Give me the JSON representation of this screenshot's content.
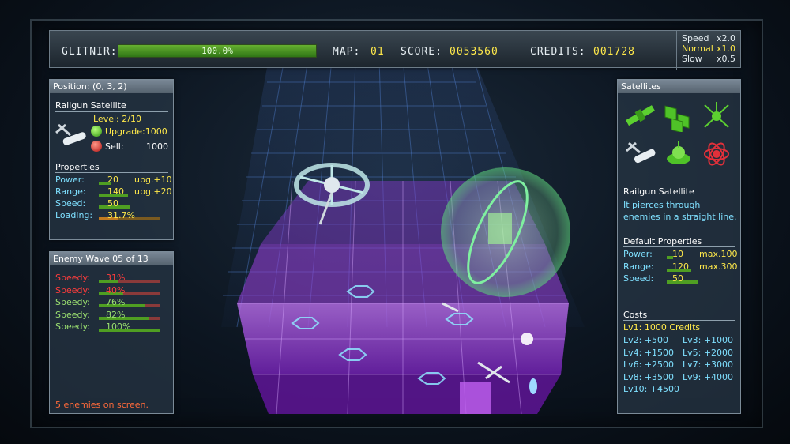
{
  "hud": {
    "ship_label": "GLITNIR:",
    "health_text": "100.0%",
    "health_fraction": 1.0,
    "map_label": "MAP:",
    "map_value": "01",
    "score_label": "SCORE:",
    "score_value": "0053560",
    "credits_label": "CREDITS:",
    "credits_value": "001728",
    "speed_options": [
      {
        "name": "Speed",
        "mult": "x2.0",
        "active": false
      },
      {
        "name": "Normal",
        "mult": "x1.0",
        "active": true
      },
      {
        "name": "Slow",
        "mult": "x0.5",
        "active": false
      }
    ]
  },
  "selected": {
    "position": "Position: (0, 3, 2)",
    "name": "Railgun Satellite",
    "level": "Level: 2/10",
    "upgrade_label": "Upgrade:1000",
    "sell_label": "Sell:",
    "sell_value": "1000",
    "properties_title": "Properties",
    "props": [
      {
        "label": "Power:",
        "value": "20",
        "extra": "upg.+10",
        "fraction": 0.2
      },
      {
        "label": "Range:",
        "value": "140",
        "extra": "upg.+20",
        "fraction": 0.47
      },
      {
        "label": "Speed:",
        "value": "50",
        "extra": "",
        "fraction": 0.5
      },
      {
        "label": "Loading:",
        "value": "31.7%",
        "extra": "",
        "fraction": 0.317
      }
    ]
  },
  "wave": {
    "title": "Enemy Wave 05 of 13",
    "enemies": [
      {
        "name": "Speedy:",
        "value": "31%",
        "health": 0.31,
        "color": "#ff3c3c"
      },
      {
        "name": "Speedy:",
        "value": "40%",
        "health": 0.4,
        "color": "#ff3c3c"
      },
      {
        "name": "Speedy:",
        "value": "76%",
        "health": 0.76,
        "color": "#9be070"
      },
      {
        "name": "Speedy:",
        "value": "82%",
        "health": 0.82,
        "color": "#9be070"
      },
      {
        "name": "Speedy:",
        "value": "100%",
        "health": 1.0,
        "color": "#9be070"
      }
    ],
    "footer": "5 enemies on screen."
  },
  "satellites": {
    "title": "Satellites",
    "icons": [
      "solar-satellite-icon",
      "panel-satellite-icon",
      "network-satellite-icon",
      "railgun-satellite-icon",
      "dish-satellite-icon",
      "orbital-satellite-icon"
    ],
    "info_name": "Railgun Satellite",
    "info_desc": "It pierces through enemies in a straight line.",
    "default_title": "Default Properties",
    "defaults": [
      {
        "label": "Power:",
        "value": "10",
        "extra": "max.100",
        "fraction": 0.1
      },
      {
        "label": "Range:",
        "value": "120",
        "extra": "max.300",
        "fraction": 0.4
      },
      {
        "label": "Speed:",
        "value": "50",
        "extra": "",
        "fraction": 0.5
      }
    ],
    "costs_title": "Costs",
    "costs_first": "Lv1: 1000 Credits",
    "costs": [
      [
        "Lv2: +500",
        "Lv3: +1000"
      ],
      [
        "Lv4: +1500",
        "Lv5: +2000"
      ],
      [
        "Lv6: +2500",
        "Lv7: +3000"
      ],
      [
        "Lv8: +3500",
        "Lv9: +4000"
      ],
      [
        "Lv10: +4500",
        ""
      ]
    ]
  },
  "colors": {
    "accent_yellow": "#ffe94a",
    "health_green": "#4f9e22",
    "grid_purple": "#9a35d8",
    "grid_blue": "#2b5c9e"
  }
}
